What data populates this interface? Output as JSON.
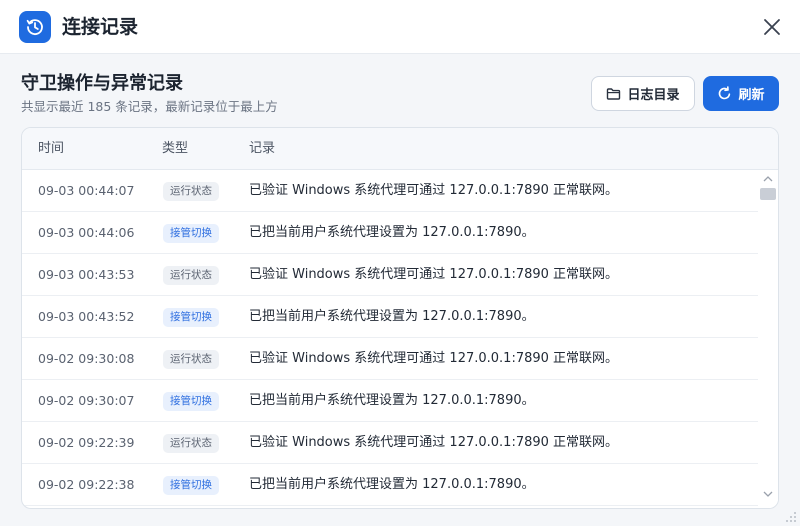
{
  "window": {
    "title": "连接记录",
    "app_icon": "history-clock-icon",
    "close_icon": "close-icon"
  },
  "section": {
    "title": "守卫操作与异常记录",
    "subtitle": "共显示最近 185 条记录，最新记录位于最上方"
  },
  "toolbar": {
    "log_dir_label": "日志目录",
    "log_dir_icon": "folder-icon",
    "refresh_label": "刷新",
    "refresh_icon": "refresh-icon"
  },
  "table": {
    "headers": {
      "time": "时间",
      "type": "类型",
      "record": "记录"
    },
    "rows": [
      {
        "time": "09-03 00:44:07",
        "type": "运行状态",
        "kind": "running",
        "record": "已验证 Windows 系统代理可通过 127.0.0.1:7890 正常联网。"
      },
      {
        "time": "09-03 00:44:06",
        "type": "接管切换",
        "kind": "takeover",
        "record": "已把当前用户系统代理设置为 127.0.0.1:7890。"
      },
      {
        "time": "09-03 00:43:53",
        "type": "运行状态",
        "kind": "running",
        "record": "已验证 Windows 系统代理可通过 127.0.0.1:7890 正常联网。"
      },
      {
        "time": "09-03 00:43:52",
        "type": "接管切换",
        "kind": "takeover",
        "record": "已把当前用户系统代理设置为 127.0.0.1:7890。"
      },
      {
        "time": "09-02 09:30:08",
        "type": "运行状态",
        "kind": "running",
        "record": "已验证 Windows 系统代理可通过 127.0.0.1:7890 正常联网。"
      },
      {
        "time": "09-02 09:30:07",
        "type": "接管切换",
        "kind": "takeover",
        "record": "已把当前用户系统代理设置为 127.0.0.1:7890。"
      },
      {
        "time": "09-02 09:22:39",
        "type": "运行状态",
        "kind": "running",
        "record": "已验证 Windows 系统代理可通过 127.0.0.1:7890 正常联网。"
      },
      {
        "time": "09-02 09:22:38",
        "type": "接管切换",
        "kind": "takeover",
        "record": "已把当前用户系统代理设置为 127.0.0.1:7890。"
      }
    ]
  },
  "colors": {
    "accent": "#1f6be0",
    "badge_running_bg": "#eef1f5",
    "badge_takeover_bg": "#e8f0fd"
  }
}
